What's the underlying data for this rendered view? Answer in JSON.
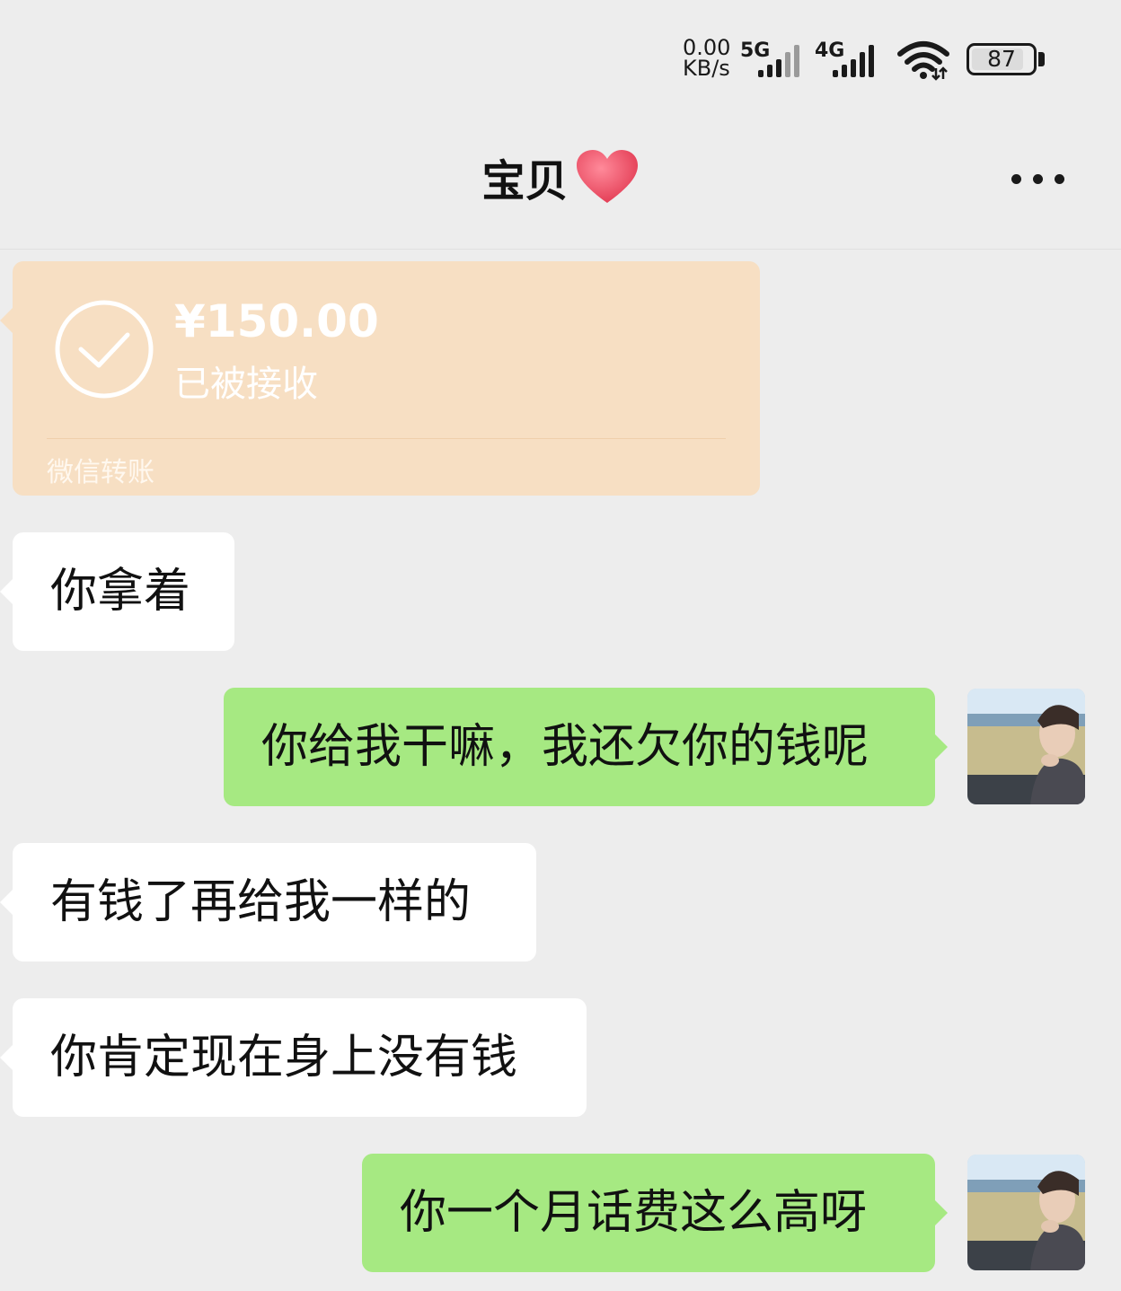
{
  "status_bar": {
    "speed_value": "0.00",
    "speed_unit": "KB/s",
    "signal1_label": "5G",
    "signal2_label": "4G",
    "battery": "87",
    "battery_level": 0.87
  },
  "header": {
    "title": "宝贝"
  },
  "transfer": {
    "amount": "¥150.00",
    "status": "已被接收",
    "footer": "微信转账"
  },
  "messages": [
    {
      "side": "in",
      "text": "你拿着"
    },
    {
      "side": "out",
      "text": "你给我干嘛，我还欠你的钱呢"
    },
    {
      "side": "in",
      "text": "有钱了再给我一样的"
    },
    {
      "side": "in",
      "text": "你肯定现在身上没有钱"
    },
    {
      "side": "out",
      "text": "你一个月话费这么高呀"
    }
  ],
  "colors": {
    "background": "#ededed",
    "incoming_bubble": "#ffffff",
    "outgoing_bubble": "#a6e982",
    "transfer_card": "#f7dfc3"
  }
}
